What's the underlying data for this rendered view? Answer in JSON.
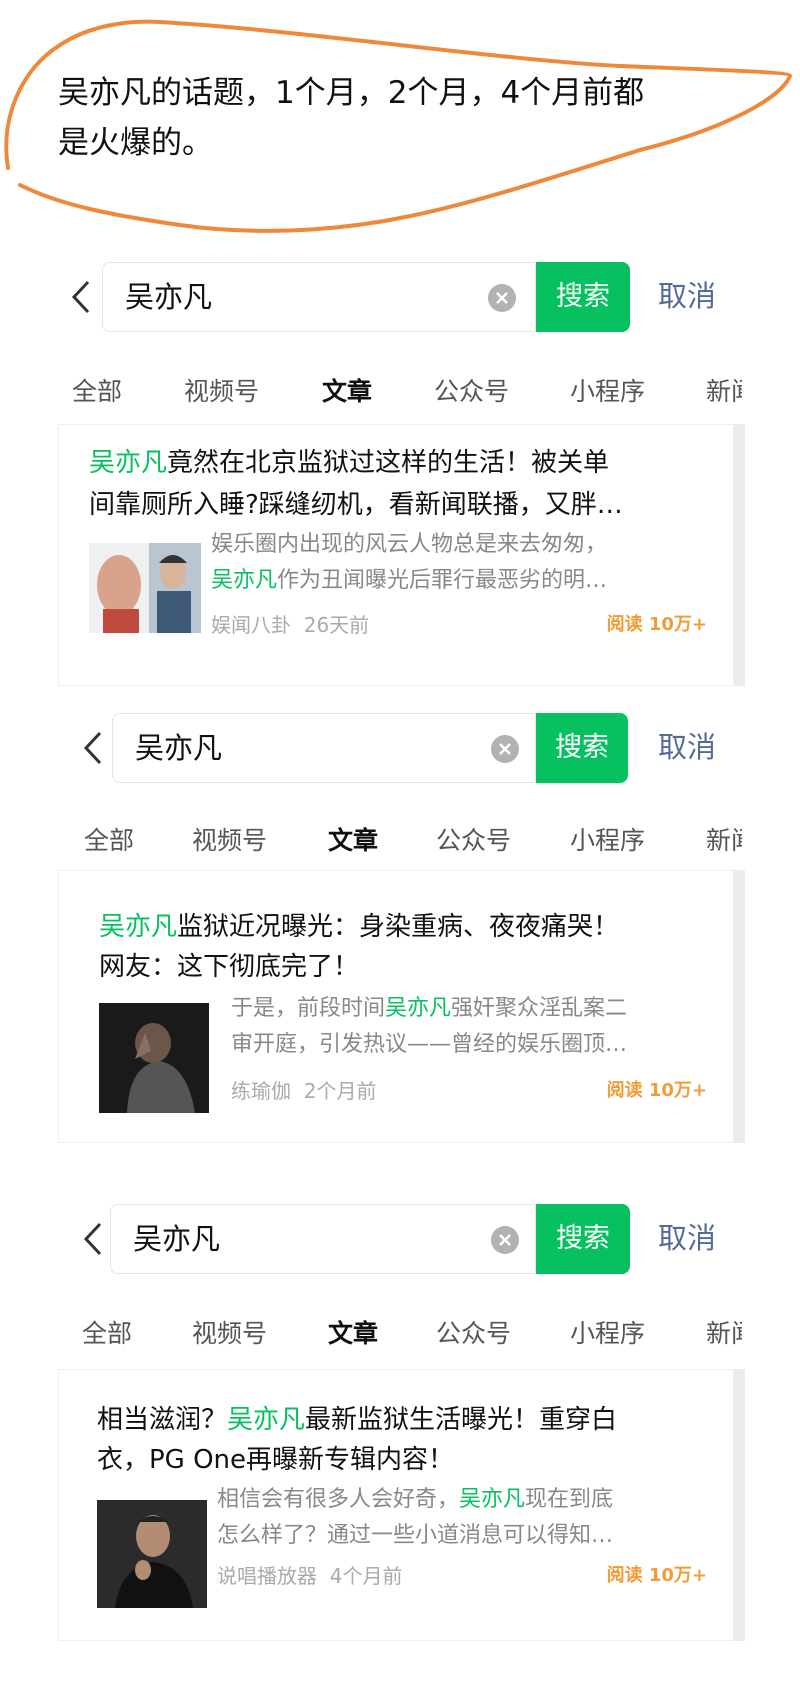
{
  "annotation": {
    "line1": "吴亦凡的话题，1个月，2个月，4个月前都",
    "line2": "是火爆的。"
  },
  "colors": {
    "accent_green": "#07c160",
    "cancel_blue": "#576b95",
    "read_orange": "#f29c38",
    "scribble_orange": "#f0883a"
  },
  "icons": {
    "back": "chevron-left-icon",
    "clear": "clear-circle-icon"
  },
  "panels": [
    {
      "search": {
        "query": "吴亦凡",
        "button": "搜索",
        "cancel": "取消"
      },
      "tabs": [
        "全部",
        "视频号",
        "文章",
        "公众号",
        "小程序",
        "新闻"
      ],
      "active_tab": "文章",
      "result": {
        "title_l1_hl": "吴亦凡",
        "title_l1_rest": "竟然在北京监狱过这样的生活！被关单",
        "title_l2": "间靠厕所入睡?踩缝纫机，看新闻联播，又胖…",
        "desc_l1_pre": "娱乐圈内出现的风云人物总是来去匆匆，",
        "desc_l2_hl": "吴亦凡",
        "desc_l2_rest": "作为丑闻曝光后罪行最恶劣的明…",
        "source": "娱闻八卦",
        "time": "26天前",
        "reads": "阅读 10万+"
      }
    },
    {
      "search": {
        "query": "吴亦凡",
        "button": "搜索",
        "cancel": "取消"
      },
      "tabs": [
        "全部",
        "视频号",
        "文章",
        "公众号",
        "小程序",
        "新闻"
      ],
      "active_tab": "文章",
      "result": {
        "title_l1_hl": "吴亦凡",
        "title_l1_rest": "监狱近况曝光：身染重病、夜夜痛哭！",
        "title_l2": "网友：这下彻底完了！",
        "desc_l1_pre": "于是，前段时间",
        "desc_l1_hl": "吴亦凡",
        "desc_l1_post": "强奸聚众淫乱案二",
        "desc_l2_rest": "审开庭，引发热议——曾经的娱乐圈顶…",
        "source": "练瑜伽",
        "time": "2个月前",
        "reads": "阅读 10万+"
      }
    },
    {
      "search": {
        "query": "吴亦凡",
        "button": "搜索",
        "cancel": "取消"
      },
      "tabs": [
        "全部",
        "视频号",
        "文章",
        "公众号",
        "小程序",
        "新闻"
      ],
      "active_tab": "文章",
      "result": {
        "title_l1_pre": "相当滋润？",
        "title_l1_hl": "吴亦凡",
        "title_l1_rest": "最新监狱生活曝光！重穿白",
        "title_l2": "衣，PG One再曝新专辑内容！",
        "desc_l1_pre": "相信会有很多人会好奇，",
        "desc_l1_hl": "吴亦凡",
        "desc_l1_post": "现在到底",
        "desc_l2_rest": "怎么样了？通过一些小道消息可以得知…",
        "source": "说唱播放器",
        "time": "4个月前",
        "reads": "阅读 10万+"
      }
    }
  ]
}
